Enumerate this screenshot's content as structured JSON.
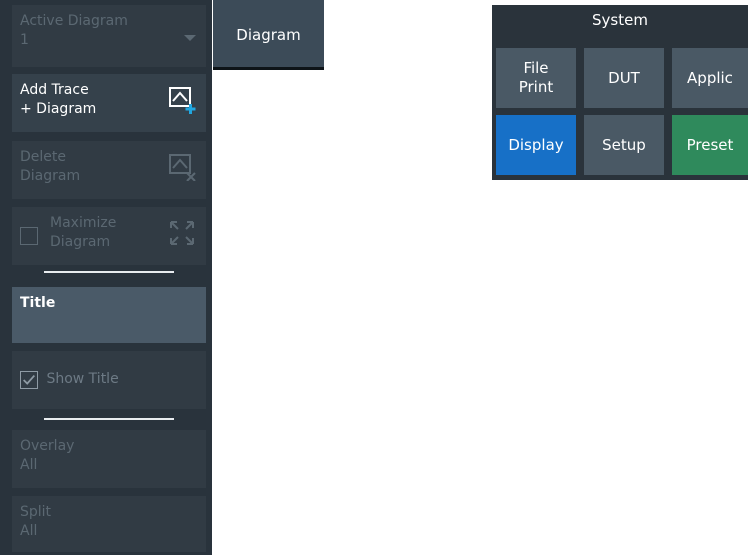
{
  "left_panel": {
    "active_diagram": {
      "label": "Active Diagram",
      "value": "1"
    },
    "add_trace_diagram": {
      "line1": "Add Trace",
      "line2": "+ Diagram"
    },
    "delete_diagram": {
      "line1": "Delete",
      "line2": "Diagram"
    },
    "maximize_diagram": {
      "line1": "Maximize",
      "line2": "Diagram"
    },
    "title": {
      "label": "Title"
    },
    "show_title": {
      "label": "Show Title"
    },
    "overlay_all": {
      "line1": "Overlay",
      "line2": "All"
    },
    "split_all": {
      "line1": "Split",
      "line2": "All"
    }
  },
  "top_tab": {
    "label": "Diagram"
  },
  "system_panel": {
    "title": "System",
    "buttons": {
      "file_print": {
        "line1": "File",
        "line2": "Print"
      },
      "dut": {
        "label": "DUT"
      },
      "applic": {
        "label": "Applic"
      },
      "display": {
        "label": "Display"
      },
      "setup": {
        "label": "Setup"
      },
      "preset": {
        "label": "Preset"
      }
    }
  },
  "colors": {
    "panel_bg": "#29333c",
    "button_bg": "#35414b",
    "display_blue": "#1770c7",
    "preset_green": "#2f8a5c",
    "accent_plus": "#21a7e0"
  }
}
